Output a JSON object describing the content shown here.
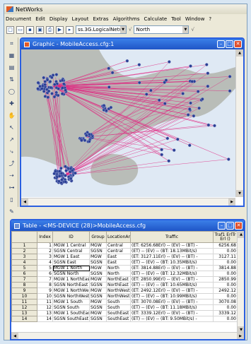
{
  "app": {
    "title": "NetWorks"
  },
  "menu": [
    "Document",
    "Edit",
    "Display",
    "Layout",
    "Extras",
    "Algorithms",
    "Calculate",
    "Tool",
    "Window",
    "?"
  ],
  "toolbar": {
    "network_combo": "ss.3G.LogicalNetwork",
    "location_combo": "North",
    "check1": "√",
    "check2": "√"
  },
  "graphic_window": {
    "title": "Graphic - MobileAccess.cfg:1"
  },
  "table_window": {
    "title": "Table - <MS-DEVICE (28)>MobileAccess.cfg",
    "columns": [
      "",
      "Index",
      "ID",
      "Group",
      "LocationAre",
      "Traffic",
      "Traf1 ErlTr Erl ()"
    ],
    "rows": [
      [
        "1",
        "1",
        "MGW 1 Central",
        "MGW",
        "Central",
        "(ET: 6256.68Erl) -- (EV) -- (BT) -",
        "6256.68"
      ],
      [
        "2",
        "2",
        "SGSN Central",
        "SGSN",
        "Central",
        "(ET) -- (EV) -- (BT: 18.13MBit/s)",
        "0.00"
      ],
      [
        "3",
        "3",
        "MGW 1 East",
        "MGW",
        "East",
        "(ET: 3127.11Erl) -- (EV) -- (BT) -",
        "3127.11"
      ],
      [
        "4",
        "4",
        "SGSN East",
        "SGSN",
        "East",
        "(ET) -- (EV) -- (BT: 10.35MBit/s)",
        "0.00"
      ],
      [
        "5",
        "5",
        "MGW 1 North",
        "MGW",
        "North",
        "(ET: 3814.88Erl) -- (EV) -- (BT) -",
        "3814.88"
      ],
      [
        "6",
        "6",
        "SGSN North",
        "SGSN",
        "North",
        "(ET) -- (EV) -- (BT: 12.32MBit/s)",
        "0.00"
      ],
      [
        "7",
        "7",
        "MGW 1 NorthEast",
        "MGW",
        "NorthEast",
        "(ET: 2850.99Erl) -- (EV) -- (BT) -",
        "2850.99"
      ],
      [
        "8",
        "8",
        "SGSN NorthEast",
        "SGSN",
        "NorthEast",
        "(ET) -- (EV) -- (BT: 10.65MBit/s)",
        "0.00"
      ],
      [
        "9",
        "9",
        "MGW 1 NorthWest",
        "MGW",
        "NorthWest",
        "(ET: 2492.12Erl) -- (EV) -- (BT) -",
        "2492.12"
      ],
      [
        "10",
        "10",
        "SGSN NorthWest",
        "SGSN",
        "NorthWest",
        "(ET) -- (EV) -- (BT: 10.99MBit/s)",
        "0.00"
      ],
      [
        "11",
        "11",
        "MGW 1 South",
        "MGW",
        "South",
        "(ET: 3070.08Erl) -- (EV) -- (BT) -",
        "3070.08"
      ],
      [
        "12",
        "12",
        "SGSN South",
        "SGSN",
        "South",
        "(ET) -- (EV) -- (BT: 11.18MBit/s)",
        "0.00"
      ],
      [
        "13",
        "13",
        "MGW 1 SouthEast",
        "MGW",
        "SouthEast",
        "(ET: 3339.12Erl) -- (EV) -- (BT) -",
        "3339.12"
      ],
      [
        "14",
        "14",
        "SGSN SouthEast",
        "SGSN",
        "SouthEast",
        "(ET) -- (EV) -- (BT: 9.50MBit/s) -",
        "0.00"
      ]
    ]
  },
  "colors": {
    "window_frame": "#2a5fe0",
    "link": "#e0267f",
    "node": "#2b3f94",
    "land": "#b9bdb8",
    "water": "#dfe9f4"
  }
}
